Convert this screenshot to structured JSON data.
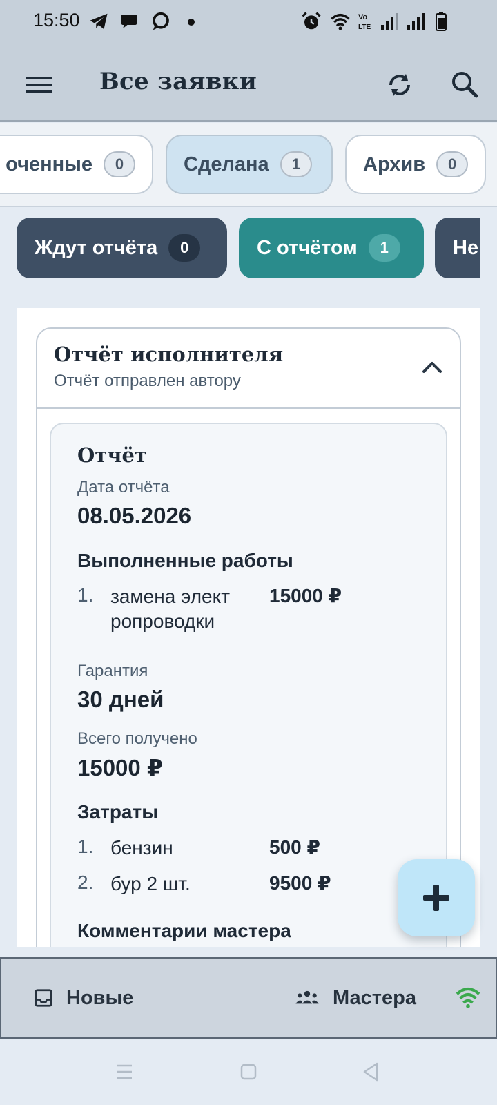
{
  "status_bar": {
    "time": "15:50",
    "left_icons": [
      "telegram-icon",
      "message-bubble-icon",
      "chat-ring-icon",
      "dot-icon"
    ],
    "right_icons": [
      "alarm-icon",
      "wifi-icon",
      "volte-icon",
      "signal-icon",
      "signal-icon",
      "battery-icon"
    ]
  },
  "app_bar": {
    "title": "Все заявки",
    "icons": [
      "menu-icon",
      "refresh-icon",
      "search-icon"
    ]
  },
  "status_tabs": [
    {
      "label": "оченные",
      "count": "0",
      "active": false
    },
    {
      "label": "Сделана",
      "count": "1",
      "active": true
    },
    {
      "label": "Архив",
      "count": "0",
      "active": false
    }
  ],
  "report_tabs": [
    {
      "label": "Ждут отчёта",
      "count": "0",
      "active": false
    },
    {
      "label": "С отчётом",
      "count": "1",
      "active": true
    },
    {
      "label": "Не",
      "active": false
    }
  ],
  "report_card": {
    "title": "Отчёт исполнителя",
    "subtitle": "Отчёт отправлен автору",
    "section_title": "Отчёт",
    "date_label": "Дата отчёта",
    "date_value": "08.05.2026",
    "works_heading": "Выполненные работы",
    "works": [
      {
        "num": "1.",
        "text": "замена элект ропроводки",
        "amount": "15000 ₽"
      }
    ],
    "warranty_label": "Гарантия",
    "warranty_value": "30 дней",
    "total_label": "Всего получено",
    "total_value": "15000 ₽",
    "costs_heading": "Затраты",
    "costs": [
      {
        "num": "1.",
        "text": "бензин",
        "amount": "500 ₽"
      },
      {
        "num": "2.",
        "text": "бур 2 шт.",
        "amount": "9500 ₽"
      }
    ],
    "comments_heading": "Комментарии мастера"
  },
  "fab": {
    "icon": "plus-icon"
  },
  "bottom_nav": [
    {
      "label": "Новые",
      "icon": "inbox-icon"
    },
    {
      "label": "Мастера",
      "icon": "people-icon"
    }
  ],
  "connection_icon": "wifi-icon",
  "colors": {
    "app_bar": "#c6d0da",
    "chip_active": "#cfe3f1",
    "chip_dark": "#3e4f64",
    "chip_teal": "#2a8c8c",
    "fab": "#bfe6f9",
    "wifi_ok": "#3aa94d"
  }
}
